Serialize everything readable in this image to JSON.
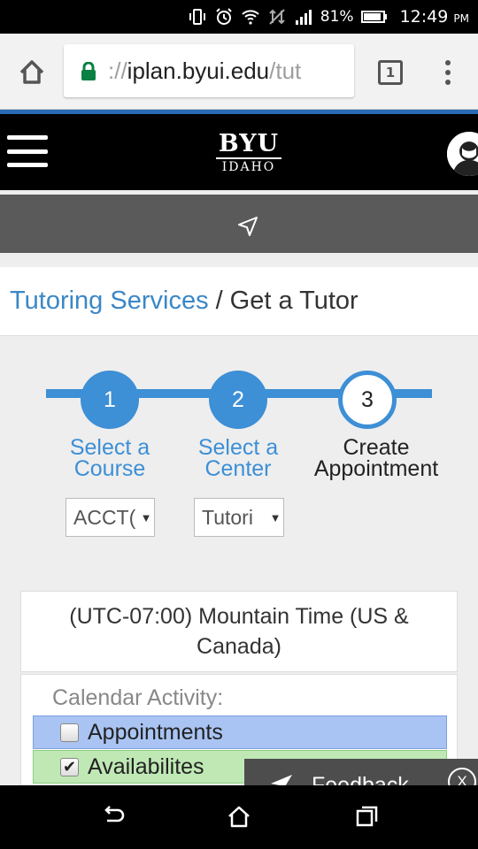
{
  "status_bar": {
    "battery_percent": "81%",
    "time": "12:49",
    "time_suffix": "PM",
    "icons": [
      "vibrate-icon",
      "alarm-icon",
      "wifi-icon",
      "no-data-icon",
      "signal-icon",
      "battery-icon"
    ]
  },
  "browser": {
    "url_scheme": "://",
    "url_host": "iplan.byui.edu",
    "url_path": "/tut",
    "tab_count": "1",
    "icons": [
      "home-icon",
      "lock-icon",
      "overflow-menu-icon"
    ]
  },
  "site_header": {
    "logo_top": "BYU",
    "logo_bottom": "IDAHO"
  },
  "breadcrumb": {
    "link": "Tutoring Services",
    "separator": "/",
    "current": "Get a Tutor"
  },
  "stepper": {
    "steps": [
      {
        "number": "1",
        "line1": "Select a",
        "line2": "Course",
        "state": "done"
      },
      {
        "number": "2",
        "line1": "Select a",
        "line2": "Center",
        "state": "done"
      },
      {
        "number": "3",
        "line1": "Create",
        "line2": "Appointment",
        "state": "current"
      }
    ],
    "selects": [
      {
        "value": "ACCT("
      },
      {
        "value": "Tutori"
      }
    ]
  },
  "timezone": {
    "label": "(UTC-07:00) Mountain Time (US & Canada)"
  },
  "calendar": {
    "heading": "Calendar Activity:",
    "legend": [
      {
        "label": "Appointments",
        "checked": false,
        "color": "#a9c4f3"
      },
      {
        "label": "Availabilites",
        "checked": true,
        "color": "#bfe8b5"
      }
    ]
  },
  "feedback": {
    "label": "Feedback",
    "close": "X"
  },
  "colors": {
    "accent": "#3d8fd6",
    "link": "#3b87c6",
    "header_bg": "#000000",
    "nav_bg": "#5a5a5a"
  }
}
